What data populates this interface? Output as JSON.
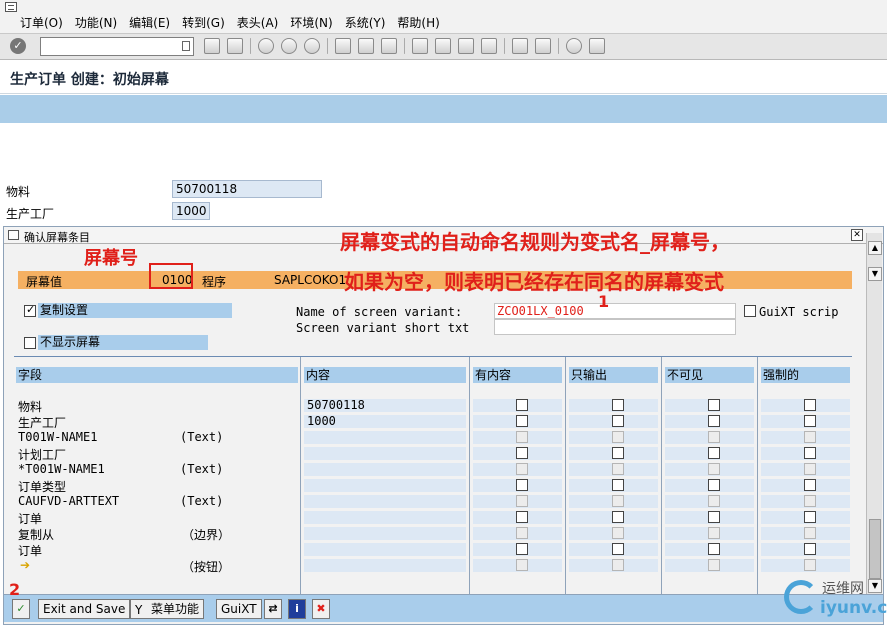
{
  "menu": [
    "订单(O)",
    "功能(N)",
    "编辑(E)",
    "转到(G)",
    "表头(A)",
    "环境(N)",
    "系统(Y)",
    "帮助(H)"
  ],
  "title": "生产订单 创建：初始屏幕",
  "main": {
    "material_label": "物料",
    "material_value": "50700118",
    "plant_label": "生产工厂",
    "plant_value": "1000"
  },
  "dialog": {
    "title": "确认屏幕条目",
    "screen_label": "屏幕值",
    "screen_value": "0100",
    "program_label": "程序",
    "program_value": "SAPLCOKO1",
    "copy_settings": "复制设置",
    "hide_screen": "不显示屏幕",
    "variant_name_label": "Name of screen variant:",
    "variant_name_value": "ZCO01LX_0100",
    "variant_short_label": "Screen variant short txt",
    "guixt_label": "GuiXT scrip",
    "columns": [
      "字段",
      "内容",
      "有内容",
      "只输出",
      "不可见",
      "强制的"
    ],
    "rows": [
      {
        "field": "物料",
        "extra": "",
        "content": "50700118",
        "enabled": true
      },
      {
        "field": "生产工厂",
        "extra": "",
        "content": "1000",
        "enabled": true
      },
      {
        "field": "T001W-NAME1",
        "extra": "(Text)",
        "content": "",
        "enabled": false
      },
      {
        "field": "计划工厂",
        "extra": "",
        "content": "",
        "enabled": true
      },
      {
        "field": "*T001W-NAME1",
        "extra": "(Text)",
        "content": "",
        "enabled": false
      },
      {
        "field": "订单类型",
        "extra": "",
        "content": "",
        "enabled": true
      },
      {
        "field": "CAUFVD-ARTTEXT",
        "extra": "(Text)",
        "content": "",
        "enabled": false
      },
      {
        "field": "订单",
        "extra": "",
        "content": "",
        "enabled": true
      },
      {
        "field": "复制从",
        "extra": "（边界）",
        "content": "",
        "enabled": false
      },
      {
        "field": "订单",
        "extra": "",
        "content": "",
        "enabled": true
      },
      {
        "field": "",
        "extra": "（按钮）",
        "content": "",
        "enabled": false
      }
    ],
    "buttons": {
      "exit_save": "Exit and Save",
      "menu_function": "菜单功能",
      "guixt": "GuiXT"
    }
  },
  "annotations": {
    "line1": "屏幕变式的自动命名规则为变式名_屏幕号，",
    "line2": "如果为空，则表明已经存在同名的屏幕变式",
    "screen_no": "屏幕号",
    "num1": "1",
    "num2": "2"
  },
  "watermark": {
    "cn": "运维网",
    "url": "iyunv.com"
  }
}
